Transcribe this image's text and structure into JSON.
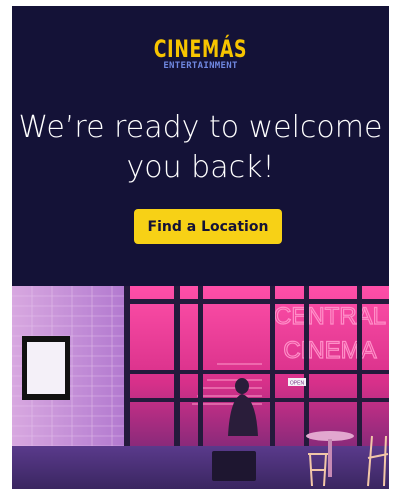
{
  "brand": {
    "name": "CINEMÁS",
    "tagline": "ENTERTAINMENT"
  },
  "hero": {
    "headline": "We’re ready to welcome you back!",
    "cta_label": "Find a Location"
  },
  "photo": {
    "sign_line1": "CENTRAL",
    "sign_line2": "CINEMA",
    "door_sign": "OPEN"
  },
  "colors": {
    "background": "#141237",
    "brand_yellow": "#f7c400",
    "button": "#f7d116",
    "brand_blue": "#6f87e0",
    "neon_pink": "#ff3d9a"
  }
}
